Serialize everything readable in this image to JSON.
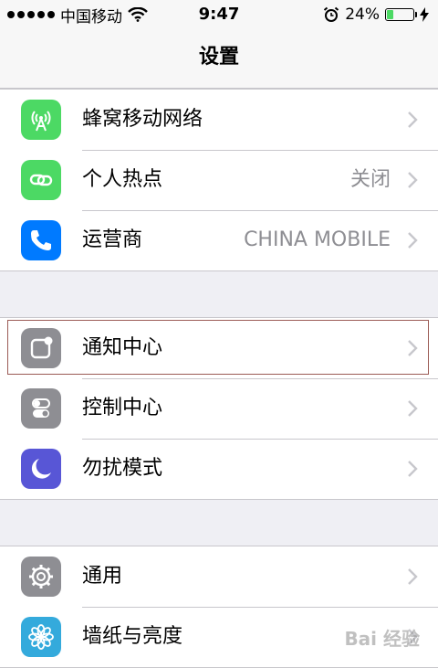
{
  "status_bar": {
    "carrier": "中国移动",
    "time": "9:47",
    "battery_percent_label": "24%",
    "battery_level": 0.24
  },
  "nav": {
    "title": "设置"
  },
  "groups": [
    {
      "rows": [
        {
          "label": "蜂窝移动网络",
          "value": "",
          "icon": "cellular-antenna-icon",
          "icon_color": "#4cd964"
        },
        {
          "label": "个人热点",
          "value": "关闭",
          "icon": "hotspot-link-icon",
          "icon_color": "#4cd964"
        },
        {
          "label": "运营商",
          "value": "CHINA MOBILE",
          "icon": "phone-icon",
          "icon_color": "#007aff"
        }
      ]
    },
    {
      "rows": [
        {
          "label": "通知中心",
          "value": "",
          "icon": "notification-center-icon",
          "icon_color": "#8e8e93",
          "highlighted": true
        },
        {
          "label": "控制中心",
          "value": "",
          "icon": "control-center-icon",
          "icon_color": "#8e8e93"
        },
        {
          "label": "勿扰模式",
          "value": "",
          "icon": "moon-icon",
          "icon_color": "#5856d6"
        }
      ]
    },
    {
      "rows": [
        {
          "label": "通用",
          "value": "",
          "icon": "gear-icon",
          "icon_color": "#8e8e93"
        },
        {
          "label": "墙纸与亮度",
          "value": "",
          "icon": "flower-icon",
          "icon_color": "#34aadc"
        }
      ]
    }
  ],
  "watermark": "Bai 经验"
}
